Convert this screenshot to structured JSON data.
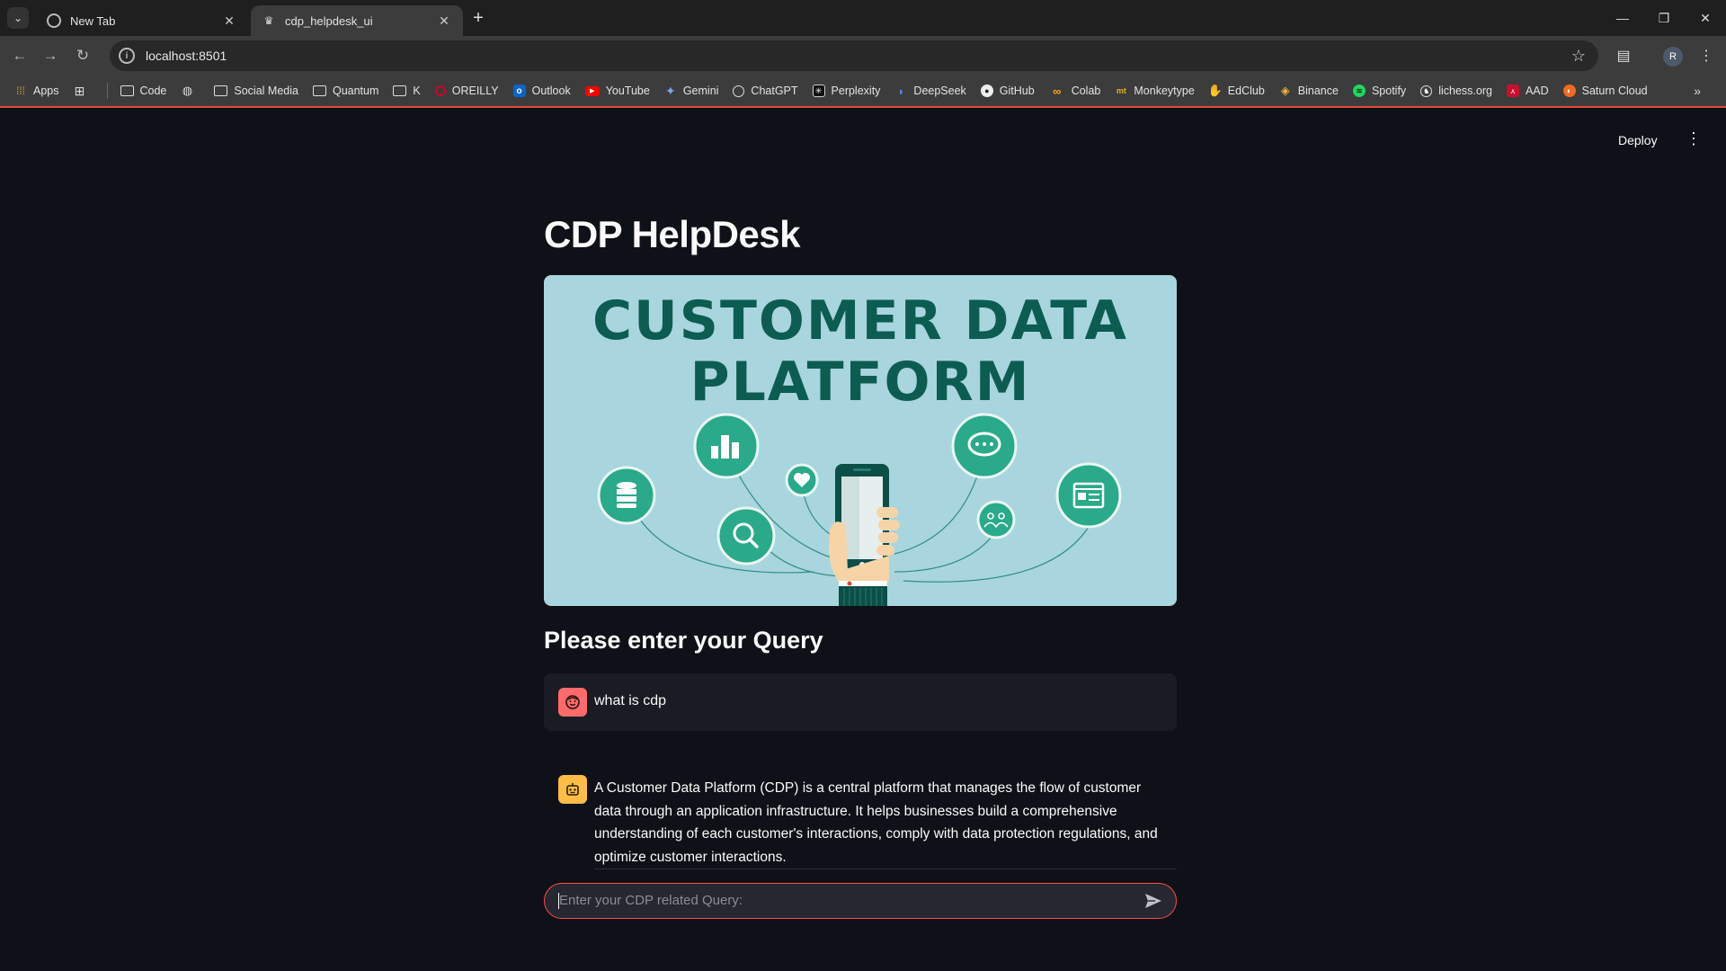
{
  "browser": {
    "tabs": [
      {
        "title": "New Tab",
        "active": false
      },
      {
        "title": "cdp_helpdesk_ui",
        "active": true
      }
    ],
    "url": "localhost:8501",
    "profile_initial": "R",
    "bookmarks": [
      {
        "label": "Apps",
        "icon": "apps-grid-icon"
      },
      {
        "label": "",
        "icon": "grid-icon"
      },
      {
        "label": "Code",
        "icon": "folder-icon"
      },
      {
        "label": "",
        "icon": "globe-icon"
      },
      {
        "label": "Social Media",
        "icon": "folder-icon"
      },
      {
        "label": "Quantum",
        "icon": "folder-icon"
      },
      {
        "label": "K",
        "icon": "folder-icon"
      },
      {
        "label": "OREILLY",
        "icon": "oreilly-icon"
      },
      {
        "label": "Outlook",
        "icon": "outlook-icon"
      },
      {
        "label": "YouTube",
        "icon": "youtube-icon"
      },
      {
        "label": "Gemini",
        "icon": "gemini-icon"
      },
      {
        "label": "ChatGPT",
        "icon": "chatgpt-icon"
      },
      {
        "label": "Perplexity",
        "icon": "perplexity-icon"
      },
      {
        "label": "DeepSeek",
        "icon": "deepseek-icon"
      },
      {
        "label": "GitHub",
        "icon": "github-icon"
      },
      {
        "label": "Colab",
        "icon": "colab-icon"
      },
      {
        "label": "Monkeytype",
        "icon": "monkeytype-icon"
      },
      {
        "label": "EdClub",
        "icon": "edclub-icon"
      },
      {
        "label": "Binance",
        "icon": "binance-icon"
      },
      {
        "label": "Spotify",
        "icon": "spotify-icon"
      },
      {
        "label": "lichess.org",
        "icon": "lichess-icon"
      },
      {
        "label": "AAD",
        "icon": "pdf-icon"
      },
      {
        "label": "Saturn Cloud",
        "icon": "saturn-cloud-icon"
      }
    ]
  },
  "app": {
    "deploy_label": "Deploy",
    "title": "CDP HelpDesk",
    "banner": {
      "line1": "CUSTOMER DATA",
      "line2": "PLATFORM"
    },
    "subheading": "Please enter your Query",
    "messages": [
      {
        "role": "user",
        "text": "what is cdp"
      },
      {
        "role": "assistant",
        "text": "A Customer Data Platform (CDP) is a central platform that manages the flow of customer data through an application infrastructure. It helps businesses build a comprehensive understanding of each customer's interactions, comply with data protection regulations, and optimize customer interactions."
      }
    ],
    "chat_input": {
      "placeholder": "Enter your CDP related Query:",
      "value": ""
    }
  },
  "colors": {
    "app_background": "#0e1117",
    "accent": "#ff4b4b",
    "user_avatar": "#ff6b6b",
    "bot_avatar": "#ffbd45",
    "banner_background": "#a9d5de",
    "banner_text": "#0d5c52",
    "banner_icon": "#2aaa8a"
  }
}
